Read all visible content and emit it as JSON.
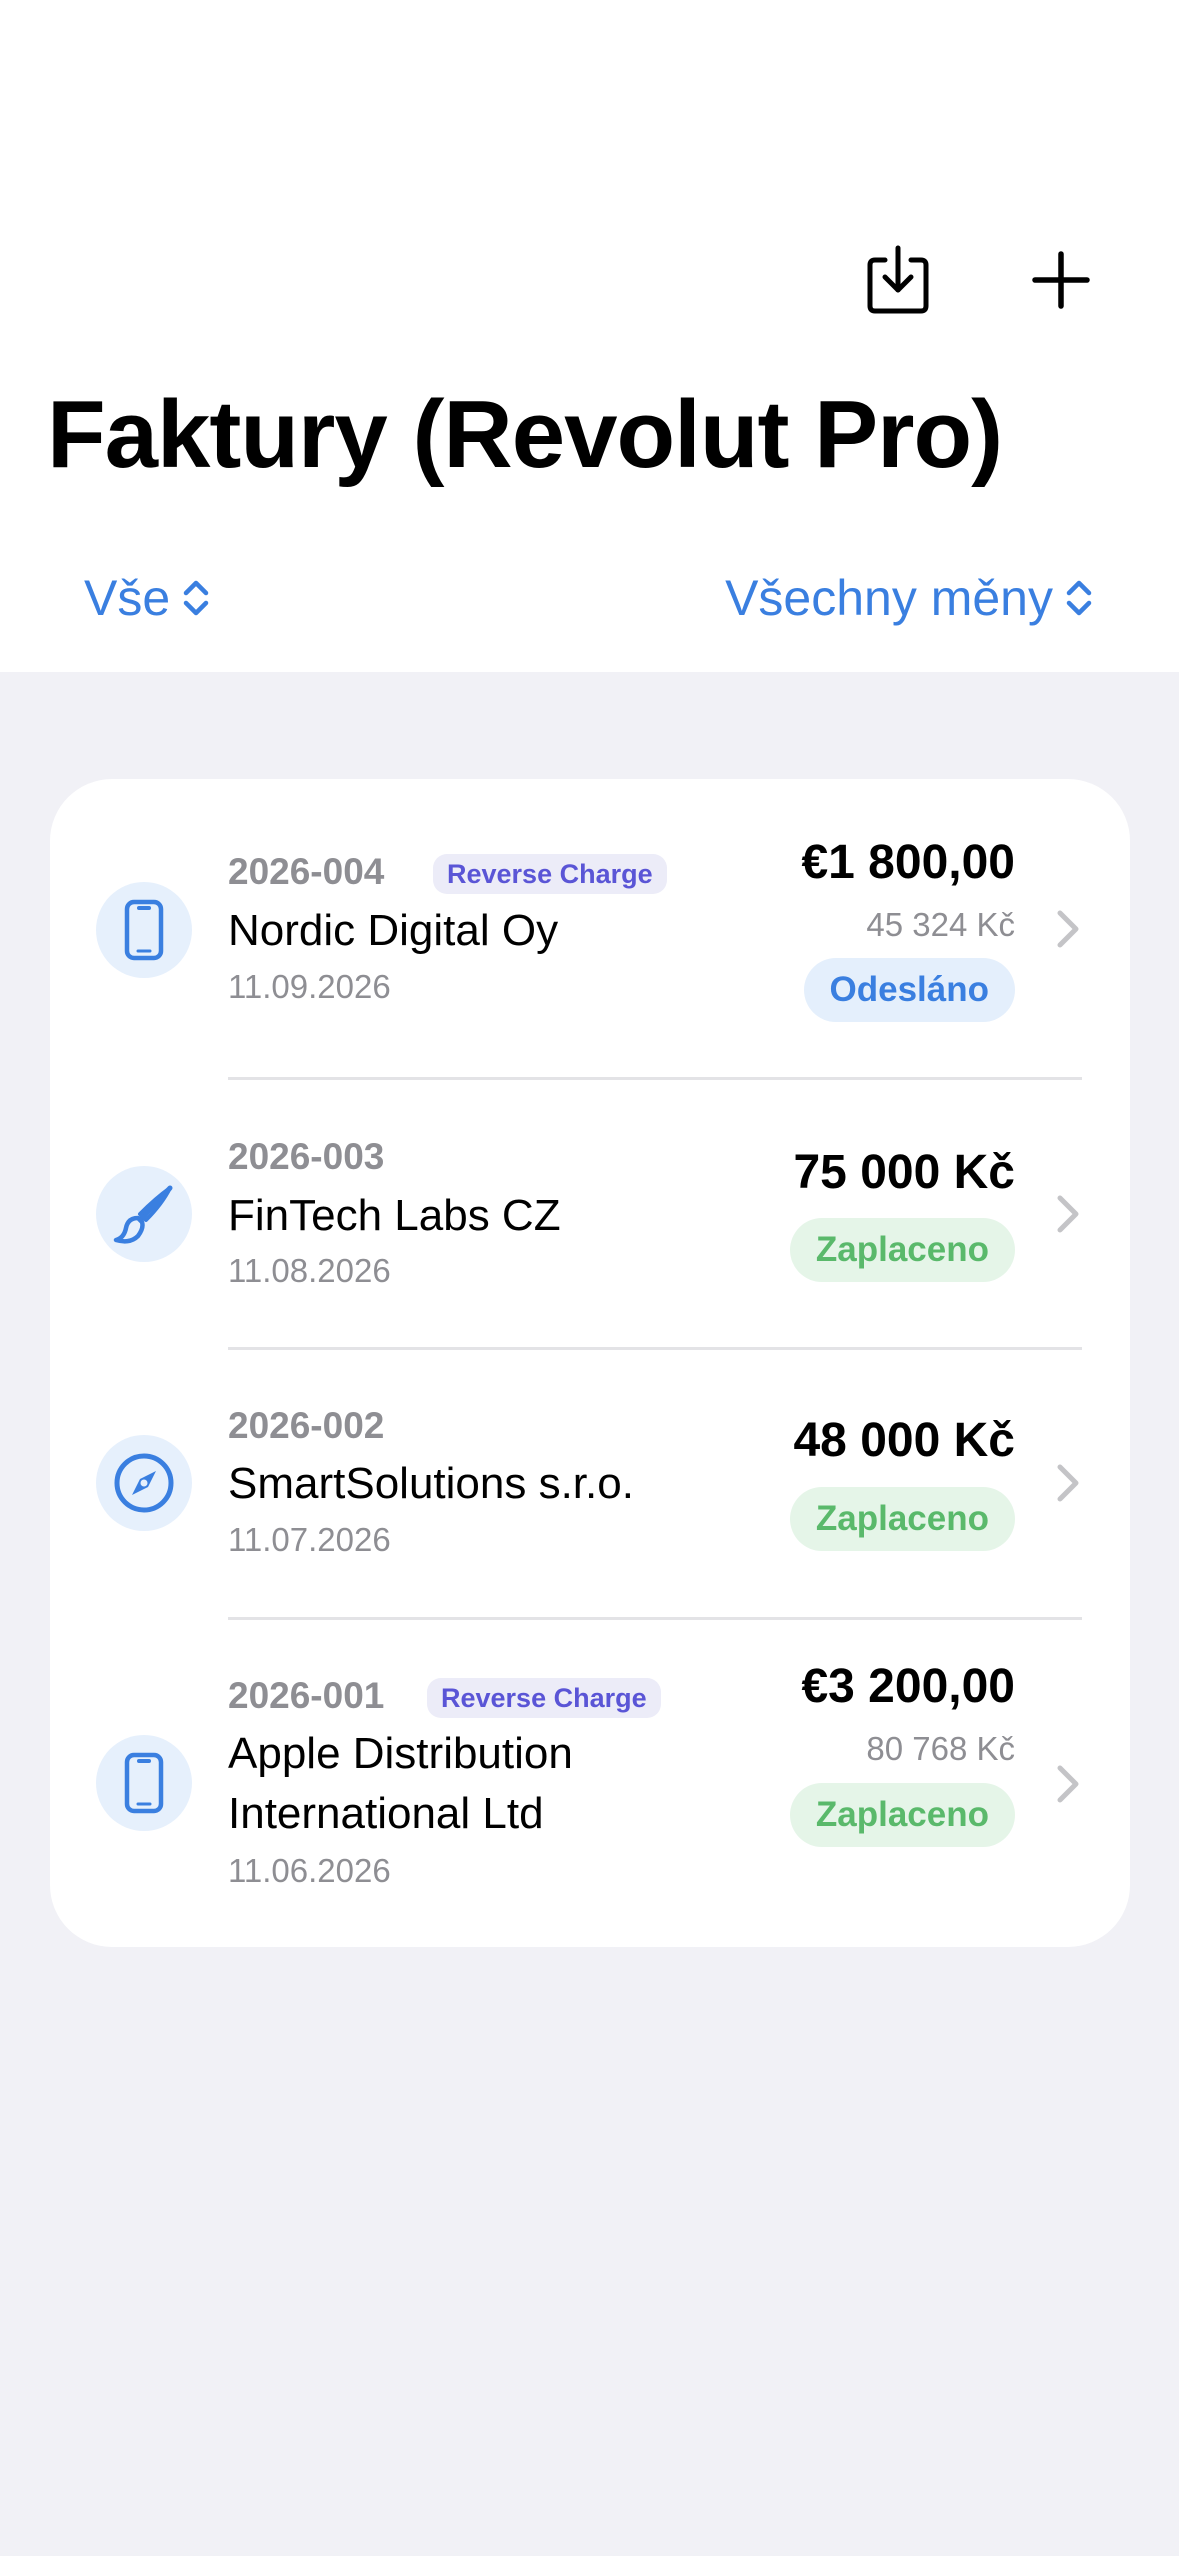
{
  "header": {
    "title": "Faktury (Revolut Pro)",
    "export_icon": "download-tray-icon",
    "add_icon": "plus-icon"
  },
  "filters": {
    "status_label": "Vše",
    "currency_label": "Všechny měny"
  },
  "invoices": [
    {
      "number": "2026-004",
      "badge": "Reverse Charge",
      "client": "Nordic Digital Oy",
      "date": "11.09.2026",
      "amount": "€1 800,00",
      "czk_amount": "45 324 Kč",
      "status": "Odesláno",
      "icon": "smartphone-icon"
    },
    {
      "number": "2026-003",
      "badge": "",
      "client": "FinTech Labs CZ",
      "date": "11.08.2026",
      "amount": "75 000 Kč",
      "czk_amount": "",
      "status": "Zaplaceno",
      "icon": "paintbrush-icon"
    },
    {
      "number": "2026-002",
      "badge": "",
      "client": "SmartSolutions s.r.o.",
      "date": "11.07.2026",
      "amount": "48 000 Kč",
      "czk_amount": "",
      "status": "Zaplaceno",
      "icon": "compass-icon"
    },
    {
      "number": "2026-001",
      "badge": "Reverse Charge",
      "client_line1": "Apple Distribution",
      "client_line2": "International Ltd",
      "date": "11.06.2026",
      "amount": "€3 200,00",
      "czk_amount": "80 768 Kč",
      "status": "Zaplaceno",
      "icon": "smartphone-icon"
    }
  ],
  "colors": {
    "accent": "#3a7fe0",
    "paid": "#5ab96b",
    "badge": "#5a55d6",
    "background": "#f1f1f6"
  }
}
